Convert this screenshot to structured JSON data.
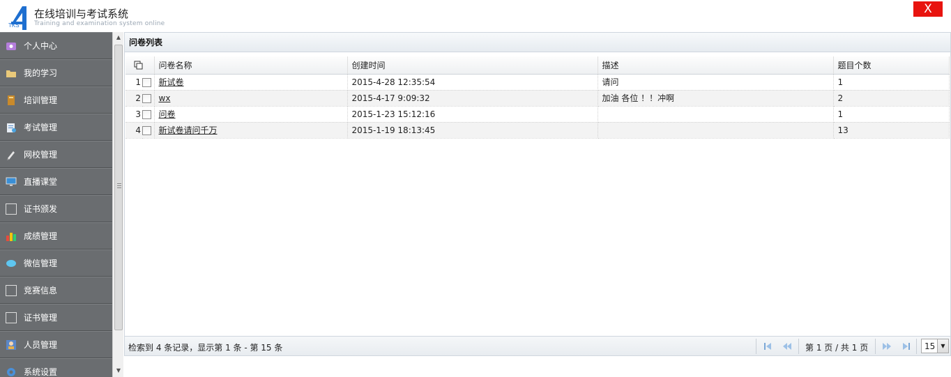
{
  "header": {
    "logo_text": "TKS",
    "title": "在线培训与考试系统",
    "subtitle": "Training and examination system online",
    "close_label": "X"
  },
  "sidebar": {
    "items": [
      {
        "label": "个人中心",
        "icon": "person-center-icon"
      },
      {
        "label": "我的学习",
        "icon": "folder-icon"
      },
      {
        "label": "培训管理",
        "icon": "book-icon"
      },
      {
        "label": "考试管理",
        "icon": "exam-paper-icon"
      },
      {
        "label": "网校管理",
        "icon": "pen-icon"
      },
      {
        "label": "直播课堂",
        "icon": "monitor-icon"
      },
      {
        "label": "证书颁发",
        "icon": "blank-icon"
      },
      {
        "label": "成绩管理",
        "icon": "bar-chart-icon"
      },
      {
        "label": "微信管理",
        "icon": "chat-bubble-icon"
      },
      {
        "label": "竞赛信息",
        "icon": "blank-icon"
      },
      {
        "label": "证书管理",
        "icon": "blank-icon"
      },
      {
        "label": "人员管理",
        "icon": "user-card-icon"
      },
      {
        "label": "系统设置",
        "icon": "gear-icon"
      }
    ]
  },
  "panel": {
    "title": "问卷列表",
    "columns": [
      "问卷名称",
      "创建时间",
      "描述",
      "题目个数"
    ],
    "rows": [
      {
        "index": "1",
        "name": "新试卷",
        "created": "2015-4-28 12:35:54",
        "desc": "请问",
        "count": "1"
      },
      {
        "index": "2",
        "name": "wx",
        "created": "2015-4-17 9:09:32",
        "desc": "加油 各位 ！！冲啊",
        "count": "2"
      },
      {
        "index": "3",
        "name": "问卷",
        "created": "2015-1-23 15:12:16",
        "desc": "",
        "count": "1"
      },
      {
        "index": "4",
        "name": "新试卷请问千万",
        "created": "2015-1-19 18:13:45",
        "desc": "",
        "count": "13"
      }
    ],
    "footer": {
      "summary": "检索到 4 条记录，显示第 1 条 - 第 15 条",
      "page_info": "第 1 页 / 共 1 页",
      "page_size": "15"
    }
  },
  "colors": {
    "sidebar_bg": "#6a6d70",
    "close_bg": "#e8140f",
    "logo_blue": "#1e6fd0"
  }
}
